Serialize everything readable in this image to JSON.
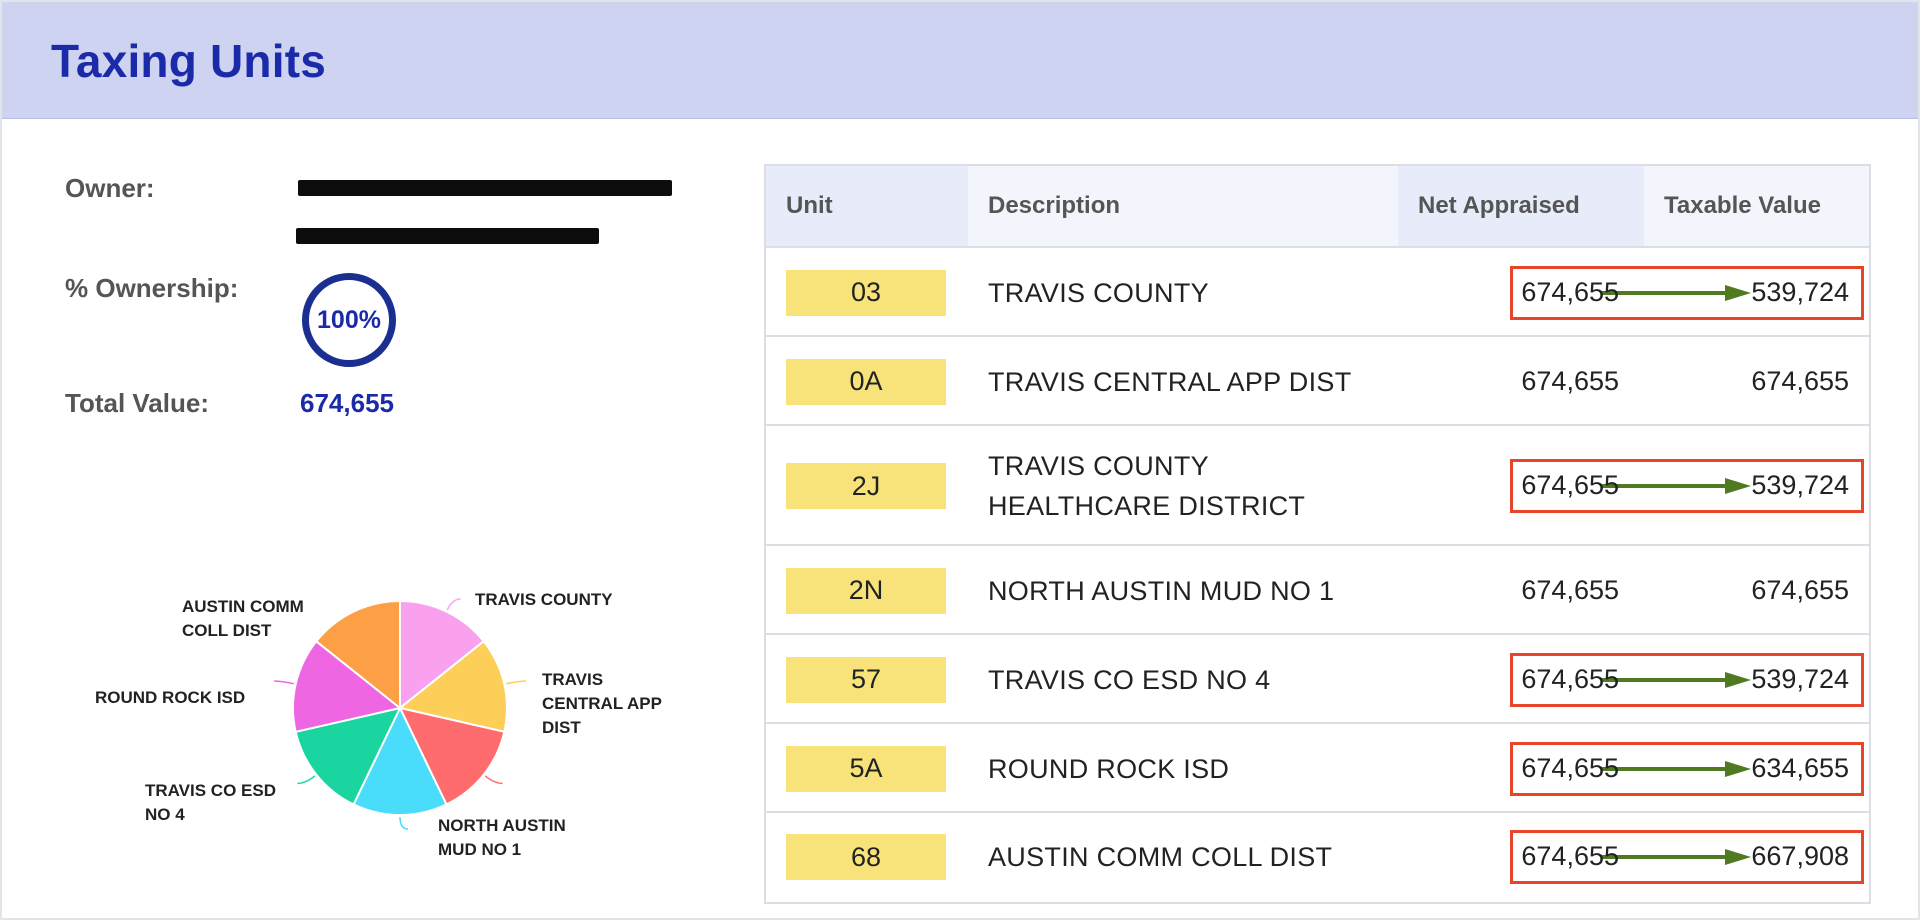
{
  "header": {
    "title": "Taxing Units"
  },
  "owner": {
    "owner_label": "Owner:",
    "ownership_label": "% Ownership:",
    "ownership_value": "100%",
    "total_label": "Total Value:",
    "total_value": "674,655"
  },
  "table": {
    "headers": {
      "unit": "Unit",
      "description": "Description",
      "net": "Net Appraised",
      "taxable": "Taxable Value"
    },
    "rows": [
      {
        "unit": "03",
        "desc1": "TRAVIS COUNTY",
        "desc2": "",
        "net": "674,655",
        "taxable": "539,724",
        "highlighted": true
      },
      {
        "unit": "0A",
        "desc1": "TRAVIS CENTRAL APP DIST",
        "desc2": "",
        "net": "674,655",
        "taxable": "674,655",
        "highlighted": false
      },
      {
        "unit": "2J",
        "desc1": "TRAVIS COUNTY",
        "desc2": "HEALTHCARE DISTRICT",
        "net": "674,655",
        "taxable": "539,724",
        "highlighted": true
      },
      {
        "unit": "2N",
        "desc1": "NORTH AUSTIN MUD NO 1",
        "desc2": "",
        "net": "674,655",
        "taxable": "674,655",
        "highlighted": false
      },
      {
        "unit": "57",
        "desc1": "TRAVIS CO ESD NO 4",
        "desc2": "",
        "net": "674,655",
        "taxable": "539,724",
        "highlighted": true
      },
      {
        "unit": "5A",
        "desc1": "ROUND ROCK ISD",
        "desc2": "",
        "net": "674,655",
        "taxable": "634,655",
        "highlighted": true
      },
      {
        "unit": "68",
        "desc1": "AUSTIN COMM COLL DIST",
        "desc2": "",
        "net": "674,655",
        "taxable": "667,908",
        "highlighted": true
      }
    ]
  },
  "pie": {
    "slices": [
      {
        "label_lines": [
          "TRAVIS COUNTY"
        ],
        "value": 1,
        "color": "#f9a0ef"
      },
      {
        "label_lines": [
          "TRAVIS",
          "CENTRAL APP",
          "DIST"
        ],
        "value": 1,
        "color": "#fdce58"
      },
      {
        "label_lines": [
          "NORTH AUSTIN",
          "MUD NO 1"
        ],
        "value": 1,
        "color": "#fe6c6d"
      },
      {
        "label_lines": [
          "TRAVIS CO ESD",
          "NO 4"
        ],
        "value": 1,
        "color": "#49dcfb"
      },
      {
        "label_lines": [
          "ROUND ROCK ISD"
        ],
        "value": 1,
        "color": "#1ad59f"
      },
      {
        "label_lines": [
          "AUSTIN COMM",
          "COLL DIST"
        ],
        "value": 1,
        "color": "#ef66e3"
      },
      {
        "label_lines": [],
        "value": 1,
        "color": "#fda045"
      }
    ]
  },
  "colors": {
    "header_bg": "#cdd3f1",
    "title": "#1a2aa8",
    "unit_badge": "#f8e37a",
    "highlight_border": "#e6452a",
    "arrow": "#4f7a1f"
  }
}
